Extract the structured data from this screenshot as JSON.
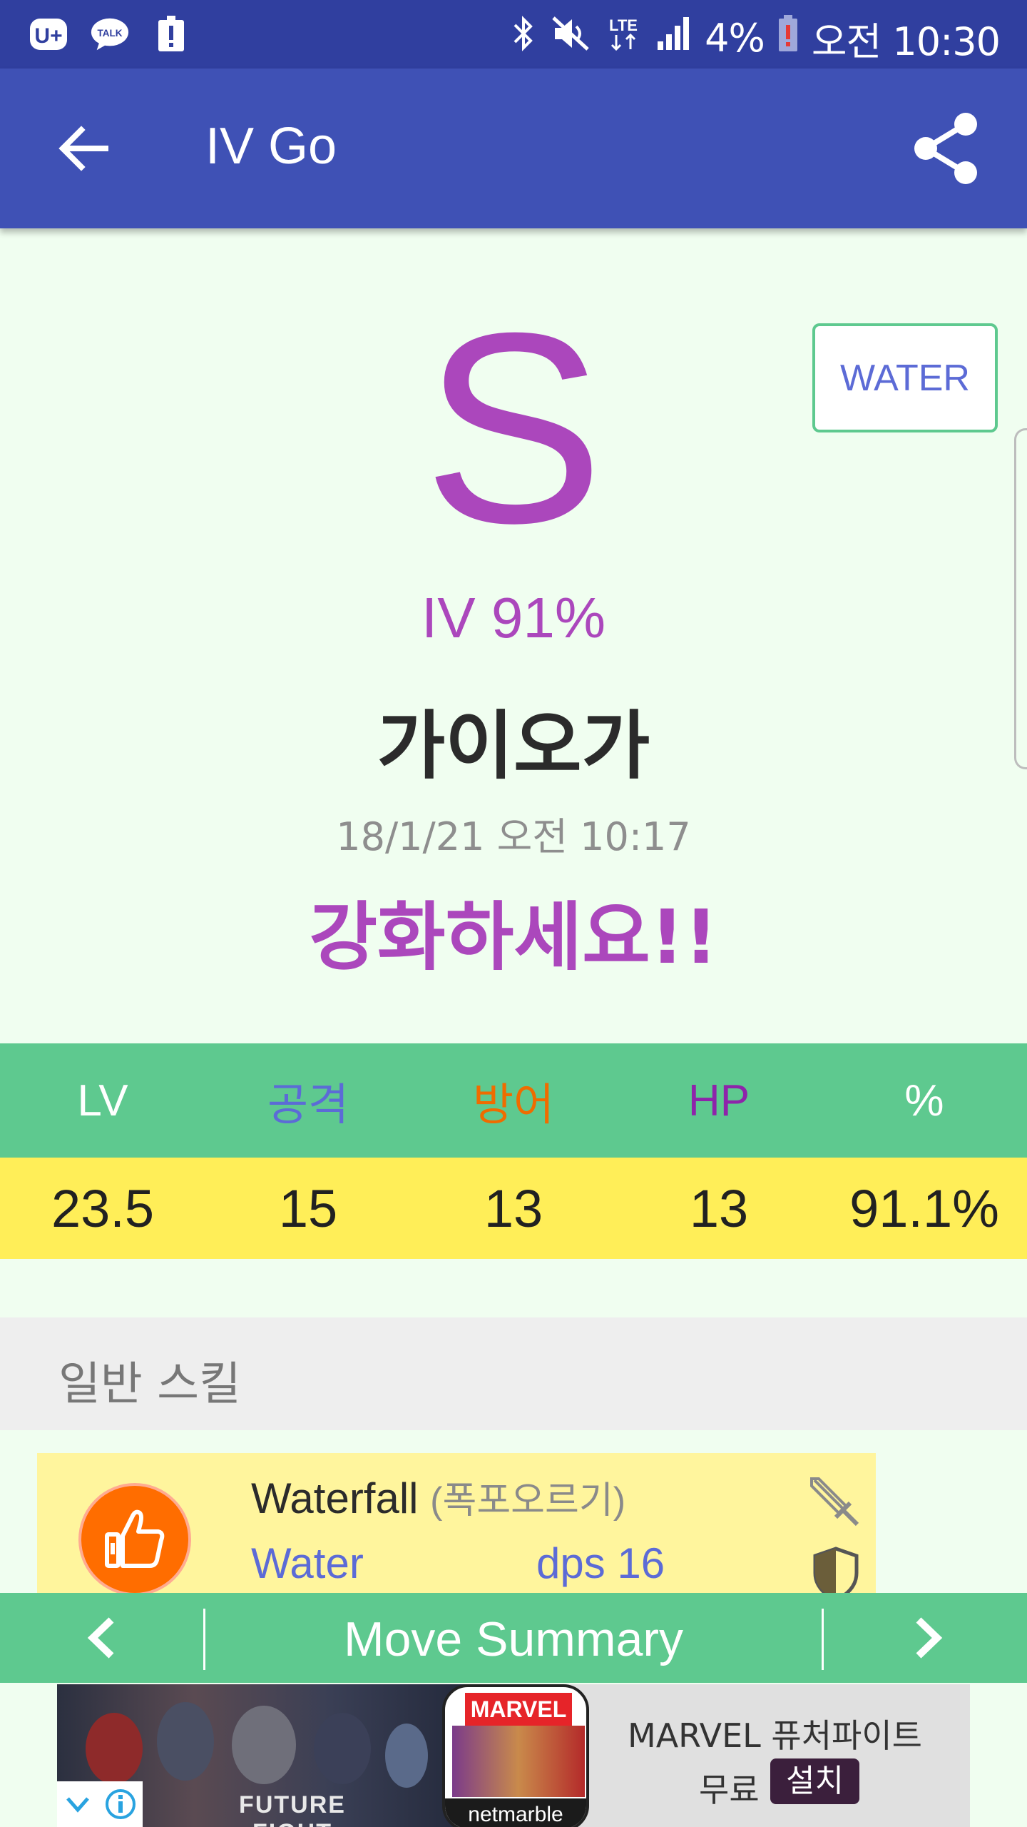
{
  "status_bar": {
    "battery": "4%",
    "time": "오전 10:30",
    "network": "LTE",
    "icons": [
      "u-plus-icon",
      "kakaotalk-icon",
      "alert-icon",
      "bluetooth-icon",
      "mute-icon",
      "lte-icon",
      "signal-icon",
      "battery-low-icon"
    ]
  },
  "app_bar": {
    "title": "IV Go",
    "back_icon": "arrow-left-icon",
    "share_icon": "share-icon"
  },
  "summary": {
    "grade": "S",
    "type": "WATER",
    "iv": "IV 91%",
    "pokemon_name": "가이오가",
    "date": "18/1/21 오전 10:17",
    "advice": "강화하세요!!"
  },
  "stats": {
    "headers": [
      {
        "label": "LV",
        "color": "#ffffff"
      },
      {
        "label": "공격",
        "color": "#5c6bd6"
      },
      {
        "label": "방어",
        "color": "#ef6c00"
      },
      {
        "label": "HP",
        "color": "#8e24aa"
      },
      {
        "label": "%",
        "color": "#ffffff"
      }
    ],
    "values": [
      "23.5",
      "15",
      "13",
      "13",
      "91.1%"
    ]
  },
  "skills": {
    "section_label": "일반 스킬",
    "items": [
      {
        "name": "Waterfall",
        "name_kr": "(폭포오르기)",
        "type": "Water",
        "dps": "dps 16",
        "badge_icon": "thumbs-up-icon"
      }
    ]
  },
  "bottom_nav": {
    "title": "Move Summary"
  },
  "ad": {
    "title": "MARVEL 퓨처파이트",
    "free": "무료",
    "install": "설치",
    "game_logo": "FUTURE FIGHT",
    "brand": "MARVEL",
    "publisher": "netmarble"
  },
  "colors": {
    "status_bar": "#303f9f",
    "app_bar": "#3f51b5",
    "accent_green": "#5ec98f",
    "accent_purple": "#ab47bc",
    "stat_row": "#ffee58",
    "background": "#f0fef0"
  }
}
